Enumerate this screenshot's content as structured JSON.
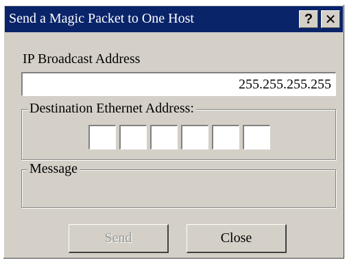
{
  "window": {
    "title": "Send a Magic Packet to One Host",
    "help_label": "?",
    "close_label": "✕"
  },
  "ip": {
    "label": "IP Broadcast Address",
    "value": "255.255.255.255"
  },
  "mac": {
    "label": "Destination Ethernet Address:",
    "octets": [
      "",
      "",
      "",
      "",
      "",
      ""
    ]
  },
  "message": {
    "label": "Message",
    "text": ""
  },
  "buttons": {
    "send": "Send",
    "send_enabled": false,
    "close": "Close"
  },
  "colors": {
    "titlebar": "#0a246a",
    "face": "#d4d0c8"
  }
}
